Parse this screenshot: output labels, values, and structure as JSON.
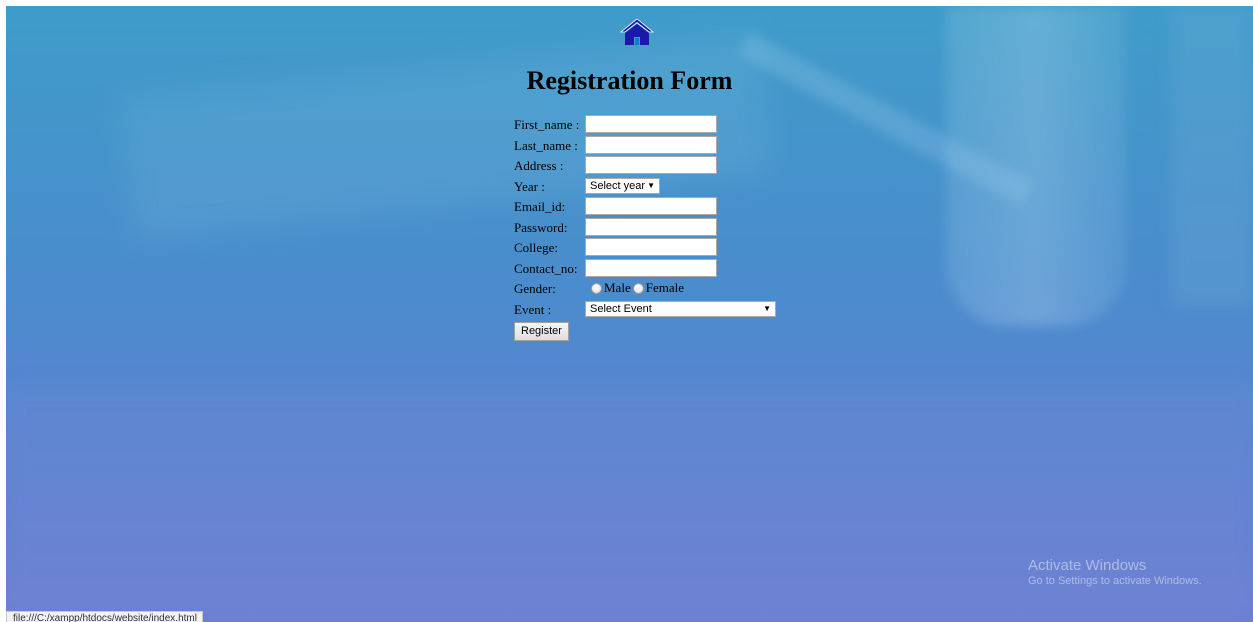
{
  "page": {
    "title": "Registration Form",
    "home_icon": "home-icon",
    "background_colors": [
      "#3e9cc9",
      "#6a7fd2"
    ]
  },
  "form": {
    "first_name_label": "First_name :",
    "last_name_label": "Last_name :",
    "address_label": "Address :",
    "year_label": "Year :",
    "year_selected": "Select year",
    "email_label": "Email_id:",
    "password_label": "Password:",
    "college_label": "College:",
    "contact_label": "Contact_no:",
    "gender_label": "Gender:",
    "gender_options": [
      "Male",
      "Female"
    ],
    "event_label": "Event :",
    "event_selected": "Select Event",
    "submit_label": "Register"
  },
  "watermark": {
    "title": "Activate Windows",
    "subtitle": "Go to Settings to activate Windows."
  },
  "status_bar": {
    "url": "file:///C:/xampp/htdocs/website/index.html"
  }
}
